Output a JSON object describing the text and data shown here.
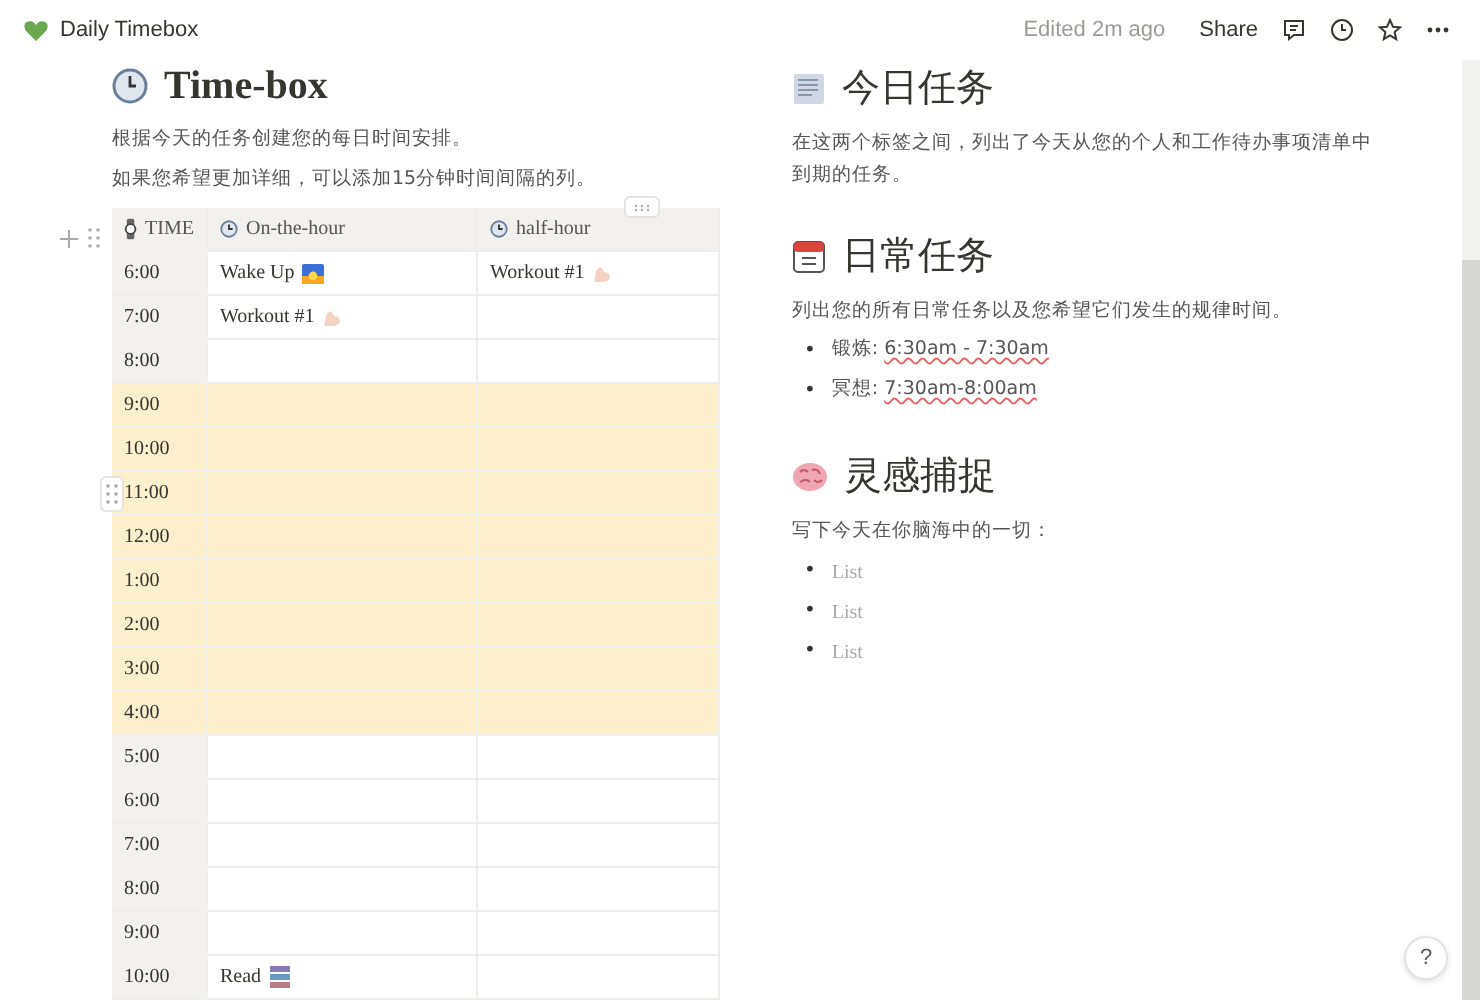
{
  "topbar": {
    "page_title": "Daily Timebox",
    "edited": "Edited 2m ago",
    "share": "Share"
  },
  "timebox": {
    "title": "Time-box",
    "notes": [
      "根据今天的任务创建您的每日时间安排。",
      "如果您希望更加详细，可以添加15分钟时间间隔的列。"
    ],
    "columns": [
      {
        "label": "TIME"
      },
      {
        "label": "On-the-hour"
      },
      {
        "label": "half-hour"
      }
    ],
    "rows": [
      {
        "time": "6:00",
        "highlighted": false,
        "on_hour": "Wake Up",
        "half_hour": "Workout #1"
      },
      {
        "time": "7:00",
        "highlighted": false,
        "on_hour": "Workout #1"
      },
      {
        "time": "8:00",
        "highlighted": false
      },
      {
        "time": "9:00",
        "highlighted": true
      },
      {
        "time": "10:00",
        "highlighted": true
      },
      {
        "time": "11:00",
        "highlighted": true
      },
      {
        "time": "12:00",
        "highlighted": true
      },
      {
        "time": "1:00",
        "highlighted": true
      },
      {
        "time": "2:00",
        "highlighted": true
      },
      {
        "time": "3:00",
        "highlighted": true
      },
      {
        "time": "4:00",
        "highlighted": true
      },
      {
        "time": "5:00",
        "highlighted": false
      },
      {
        "time": "6:00",
        "highlighted": false
      },
      {
        "time": "7:00",
        "highlighted": false
      },
      {
        "time": "8:00",
        "highlighted": false
      },
      {
        "time": "9:00",
        "highlighted": false
      },
      {
        "time": "10:00",
        "highlighted": false,
        "on_hour": "Read"
      }
    ]
  },
  "sections": [
    {
      "title": "今日任务",
      "description": "在这两个标签之间，列出了今天从您的个人和工作待办事项清单中到期的任务。"
    },
    {
      "title": "日常任务",
      "description": "列出您的所有日常任务以及您希望它们发生的规律时间。",
      "items": [
        {
          "kind": "entry",
          "bullet": "•",
          "label": "锻炼:",
          "time": "6:30am - 7:30am"
        },
        {
          "kind": "entry",
          "bullet": "•",
          "label": "冥想:",
          "time": "7:30am-8:00am"
        }
      ]
    },
    {
      "title": "灵感捕捉",
      "description": "写下今天在你脑海中的一切：",
      "items": [
        {
          "kind": "empty",
          "bullet": "•",
          "placeholder": "List"
        },
        {
          "kind": "empty",
          "bullet": "•",
          "placeholder": "List"
        },
        {
          "kind": "empty",
          "bullet": "•",
          "placeholder": "List"
        }
      ]
    }
  ],
  "help": "?"
}
